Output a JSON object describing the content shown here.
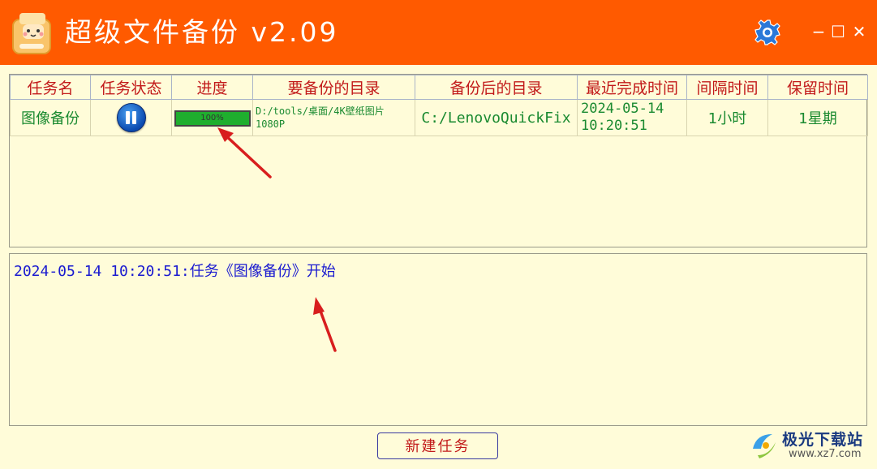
{
  "app": {
    "title": "超级文件备份  v2.09"
  },
  "window_controls": {
    "minimize": "−",
    "maximize": "☐",
    "close": "✕"
  },
  "table": {
    "headers": [
      "任务名",
      "任务状态",
      "进度",
      "要备份的目录",
      "备份后的目录",
      "最近完成时间",
      "间隔时间",
      "保留时间"
    ],
    "rows": [
      {
        "name": "图像备份",
        "status": "paused",
        "progress_label": "100%",
        "progress_value": 1.0,
        "source_dir_line1": "D:/tools/桌面/4K壁纸图片",
        "source_dir_line2": "1080P",
        "dest_dir": "C:/LenovoQuickFix",
        "last_date": "2024-05-14",
        "last_time": "10:20:51",
        "interval": "1小时",
        "retention": "1星期"
      }
    ]
  },
  "log": {
    "lines": [
      "2024-05-14 10:20:51:任务《图像备份》开始"
    ]
  },
  "buttons": {
    "new_task": "新建任务"
  },
  "watermark": {
    "name": "极光下载站",
    "url": "www.xz7.com"
  },
  "colors": {
    "titlebar": "#ff5a00",
    "background": "#fffcd9",
    "header_text": "#c21a1a",
    "cell_text": "#1a8a30",
    "log_text": "#1a1ad0",
    "progress_fill": "#1fae2e",
    "annotation_arrow": "#d81e1e"
  }
}
